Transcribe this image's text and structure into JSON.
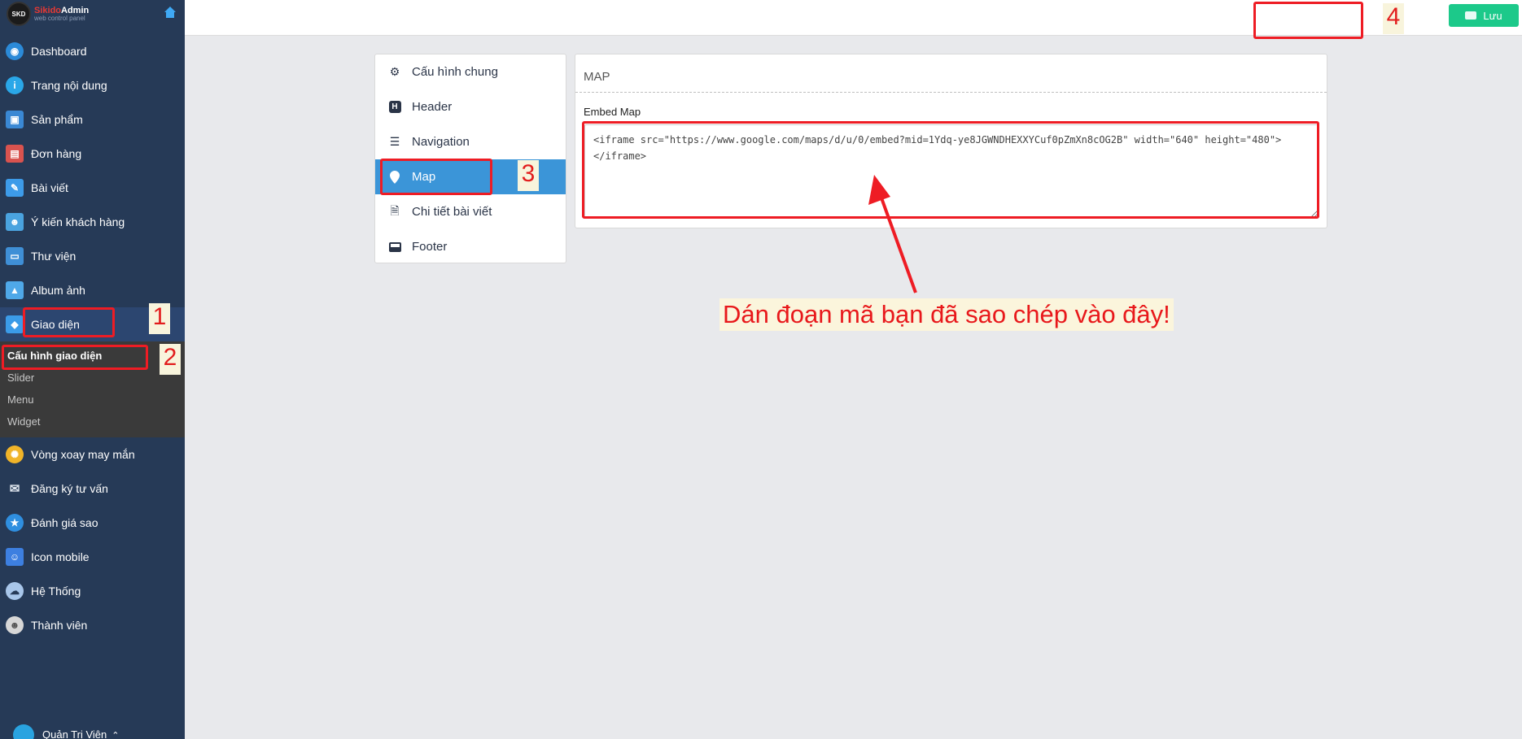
{
  "brand": {
    "logo_text": "SKD",
    "name_part1": "Sikido",
    "name_part2": "Admin",
    "subtitle": "web control panel"
  },
  "sidebar": {
    "items": [
      {
        "label": "Dashboard",
        "icon": "dashboard-icon",
        "color": "#2b8ad8"
      },
      {
        "label": "Trang nội dung",
        "icon": "info-icon",
        "color": "#2aa7e8"
      },
      {
        "label": "Sản phẩm",
        "icon": "box-icon",
        "color": "#3a88d4"
      },
      {
        "label": "Đơn hàng",
        "icon": "store-icon",
        "color": "#d9534f"
      },
      {
        "label": "Bài viết",
        "icon": "edit-icon",
        "color": "#3d9be9"
      },
      {
        "label": "Ý kiến khách hàng",
        "icon": "users-icon",
        "color": "#4aa3df"
      },
      {
        "label": "Thư viện",
        "icon": "library-icon",
        "color": "#3f8fd6"
      },
      {
        "label": "Album ảnh",
        "icon": "image-icon",
        "color": "#4fa8e8"
      },
      {
        "label": "Giao diện",
        "icon": "layers-icon",
        "color": "#3b9be8"
      }
    ],
    "submenu": [
      {
        "label": "Cấu hình giao diện"
      },
      {
        "label": "Slider"
      },
      {
        "label": "Menu"
      },
      {
        "label": "Widget"
      }
    ],
    "items_after": [
      {
        "label": "Vòng xoay may mắn",
        "icon": "wheel-icon",
        "color": "#f0b429"
      },
      {
        "label": "Đăng ký tư vấn",
        "icon": "mail-icon",
        "color": "#dfe6ee"
      },
      {
        "label": "Đánh giá sao",
        "icon": "star-icon",
        "color": "#2f8fe0"
      },
      {
        "label": "Icon mobile",
        "icon": "mobile-icon",
        "color": "#3d7fe0"
      },
      {
        "label": "Hệ Thống",
        "icon": "cloud-settings-icon",
        "color": "#a8c6ea"
      },
      {
        "label": "Thành viên",
        "icon": "member-icon",
        "color": "#d7d7d7"
      }
    ],
    "user": "Quản Trị Viên"
  },
  "topbar": {
    "save_label": "Lưu"
  },
  "config_nav": {
    "items": [
      {
        "label": "Cấu hình chung",
        "icon": "cogs-icon"
      },
      {
        "label": "Header",
        "icon": "header-icon"
      },
      {
        "label": "Navigation",
        "icon": "bars-icon"
      },
      {
        "label": "Map",
        "icon": "map-marker-icon"
      },
      {
        "label": "Chi tiết bài viết",
        "icon": "file-icon"
      },
      {
        "label": "Footer",
        "icon": "footer-icon"
      }
    ]
  },
  "map_panel": {
    "title": "MAP",
    "field_label": "Embed Map",
    "embed_value": "<iframe src=\"https://www.google.com/maps/d/u/0/embed?mid=1Ydq-ye8JGWNDHEXXYCuf0pZmXn8cOG2B\" width=\"640\" height=\"480\"></iframe>"
  },
  "annotations": {
    "n1": "1",
    "n2": "2",
    "n3": "3",
    "n4": "4",
    "callout": "Dán đoạn mã bạn đã sao chép vào đây!",
    "color": "#ee1c24"
  }
}
